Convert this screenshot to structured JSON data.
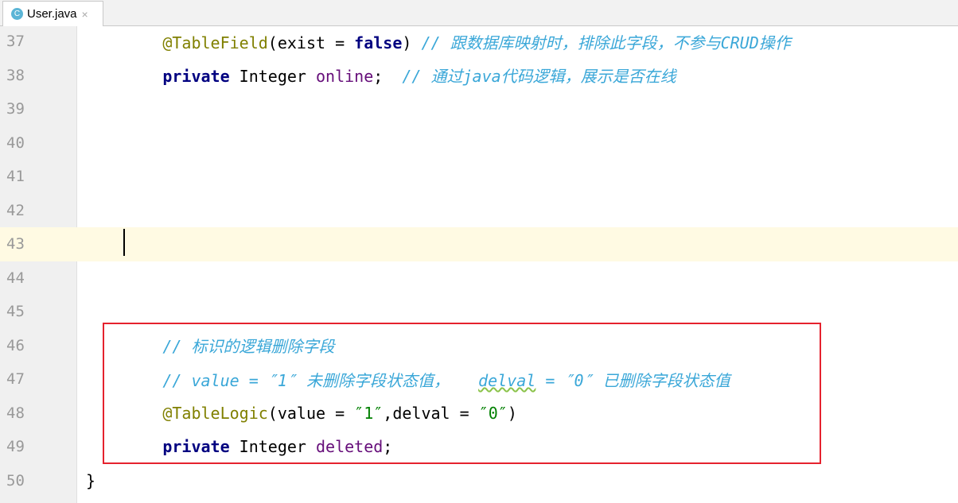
{
  "tab": {
    "icon": "C",
    "title": "User.java",
    "close": "×"
  },
  "colors": {
    "highlight_box": "#e5222e",
    "comment": "#3aa7d8",
    "keyword": "#000080"
  },
  "lines": [
    {
      "n": "37",
      "tokens": [
        [
          "        ",
          ""
        ],
        [
          "@TableField",
          "ann"
        ],
        [
          "(exist = ",
          ""
        ],
        [
          "false",
          "kw"
        ],
        [
          ") ",
          ""
        ],
        [
          "// 跟数据库映射时，排除此字段，不参与CRUD操作",
          "cmt"
        ]
      ]
    },
    {
      "n": "38",
      "tokens": [
        [
          "        ",
          ""
        ],
        [
          "private",
          "kw"
        ],
        [
          " Integer ",
          ""
        ],
        [
          "online",
          "fld"
        ],
        [
          ";  ",
          ""
        ],
        [
          "// 通过java代码逻辑，展示是否在线",
          "cmt"
        ]
      ]
    },
    {
      "n": "39",
      "tokens": []
    },
    {
      "n": "40",
      "tokens": []
    },
    {
      "n": "41",
      "tokens": []
    },
    {
      "n": "42",
      "tokens": []
    },
    {
      "n": "43",
      "tokens": [],
      "current": true
    },
    {
      "n": "44",
      "tokens": []
    },
    {
      "n": "45",
      "tokens": []
    },
    {
      "n": "46",
      "tokens": [
        [
          "        ",
          ""
        ],
        [
          "// 标识的逻辑删除字段",
          "cmt"
        ]
      ]
    },
    {
      "n": "47",
      "tokens": [
        [
          "        ",
          ""
        ],
        [
          "// value = ″1″ 未删除字段状态值，   ",
          "cmt"
        ],
        [
          "delval",
          "cmt wavy"
        ],
        [
          " = ″0″ 已删除字段状态值",
          "cmt"
        ]
      ]
    },
    {
      "n": "48",
      "tokens": [
        [
          "        ",
          ""
        ],
        [
          "@TableLogic",
          "ann"
        ],
        [
          "(value = ",
          ""
        ],
        [
          "″1″",
          "str"
        ],
        [
          ",delval = ",
          ""
        ],
        [
          "″0″",
          "str"
        ],
        [
          ")",
          ""
        ]
      ]
    },
    {
      "n": "49",
      "tokens": [
        [
          "        ",
          ""
        ],
        [
          "private",
          "kw"
        ],
        [
          " Integer ",
          ""
        ],
        [
          "deleted",
          "fld"
        ],
        [
          ";",
          ""
        ]
      ]
    },
    {
      "n": "50",
      "tokens": [
        [
          "}",
          ""
        ]
      ]
    }
  ]
}
